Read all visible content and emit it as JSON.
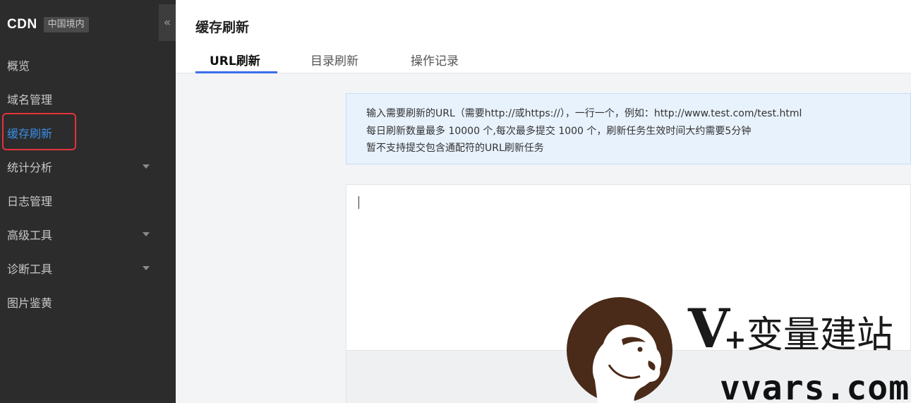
{
  "sidebar": {
    "brand": "CDN",
    "region_badge": "中国境内",
    "collapse_icon": "«",
    "items": [
      {
        "label": "概览",
        "has_submenu": false,
        "active": false
      },
      {
        "label": "域名管理",
        "has_submenu": false,
        "active": false
      },
      {
        "label": "缓存刷新",
        "has_submenu": false,
        "active": true
      },
      {
        "label": "统计分析",
        "has_submenu": true,
        "active": false
      },
      {
        "label": "日志管理",
        "has_submenu": false,
        "active": false
      },
      {
        "label": "高级工具",
        "has_submenu": true,
        "active": false
      },
      {
        "label": "诊断工具",
        "has_submenu": true,
        "active": false
      },
      {
        "label": "图片鉴黄",
        "has_submenu": false,
        "active": false
      }
    ]
  },
  "main": {
    "title": "缓存刷新",
    "tabs": [
      {
        "label": "URL刷新",
        "active": true
      },
      {
        "label": "目录刷新",
        "active": false
      },
      {
        "label": "操作记录",
        "active": false
      }
    ],
    "notice": {
      "lines": [
        "输入需要刷新的URL（需要http://或https://），一行一个，例如：http://www.test.com/test.html",
        "每日刷新数量最多 10000 个,每次最多提交 1000 个，刷新任务生效时间大约需要5分钟",
        "暂不支持提交包含通配符的URL刷新任务"
      ]
    },
    "url_input": {
      "value": ""
    }
  },
  "watermark": {
    "logo_icon": "gorilla-logo-icon",
    "v": "V",
    "plus": "+",
    "name": "变量建站",
    "domain": "vvars.com"
  },
  "colors": {
    "sidebar_bg": "#2c2c2c",
    "active_blue": "#3a8ee6",
    "tab_underline": "#3a6ee8",
    "highlight_red": "#e2333a",
    "notice_bg": "#e8f2fd",
    "watermark_brown": "#4a2a18"
  }
}
